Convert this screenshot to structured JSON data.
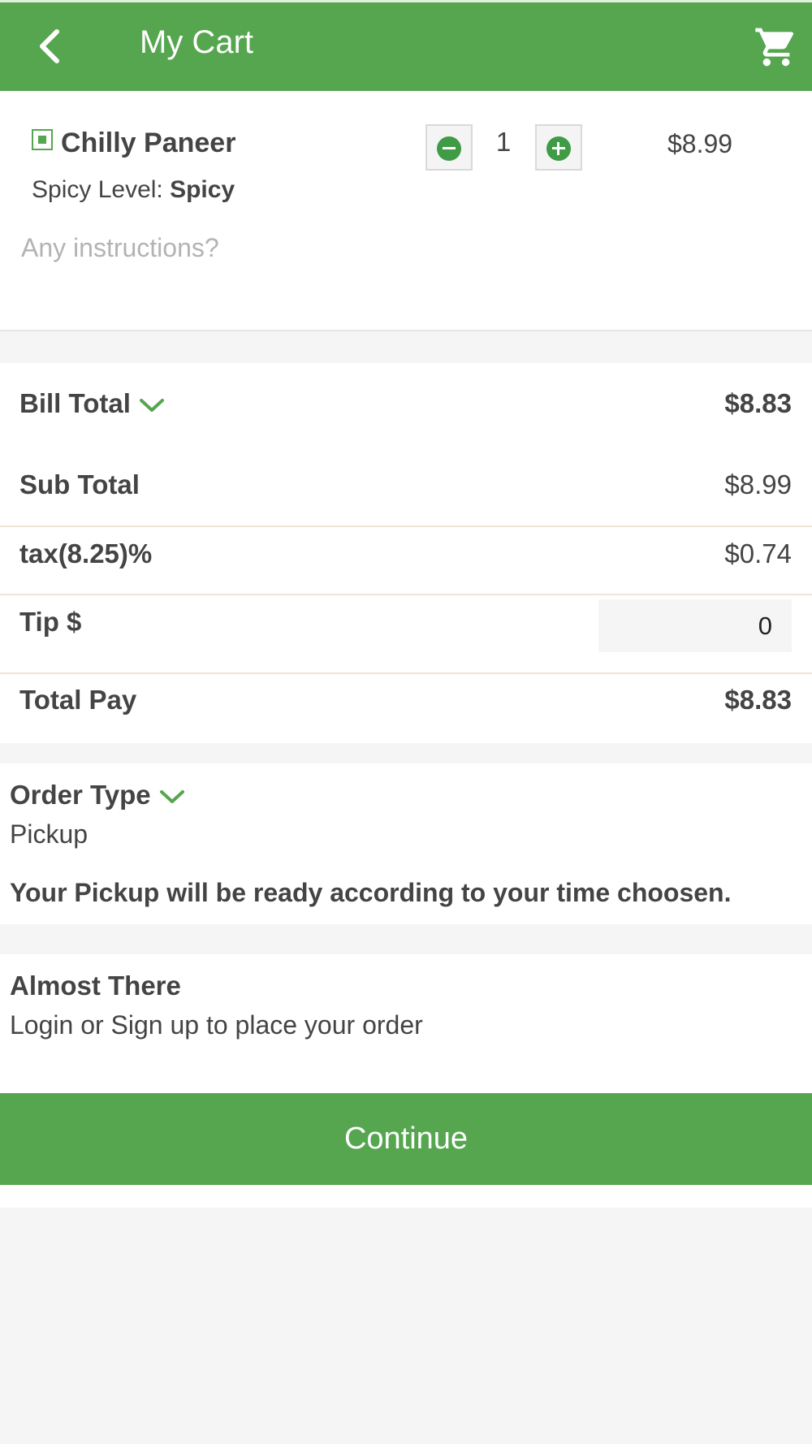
{
  "header": {
    "title": "My Cart",
    "back_icon": "chevron-left-icon",
    "cart_icon": "shopping-cart-icon"
  },
  "cart_item": {
    "name": "Chilly Paneer",
    "veg_icon": "veg-indicator-icon",
    "quantity": "1",
    "price": "$8.99",
    "spicy_label": "Spicy Level:",
    "spicy_value": "Spicy",
    "instructions_placeholder": "Any instructions?",
    "instructions_value": ""
  },
  "bill": {
    "bill_total_label": "Bill Total",
    "bill_total_value": "$8.83",
    "sub_total_label": "Sub Total",
    "sub_total_value": "$8.99",
    "tax_label": "tax(8.25)%",
    "tax_value": "$0.74",
    "tip_label": "Tip $",
    "tip_value": "0",
    "total_pay_label": "Total Pay",
    "total_pay_value": "$8.83"
  },
  "order": {
    "title": "Order Type",
    "type": "Pickup",
    "note": "Your Pickup will be ready according to your time choosen."
  },
  "checkout": {
    "title": "Almost There",
    "subtitle": "Login or Sign up to place your order",
    "continue_label": "Continue"
  },
  "colors": {
    "brand_green": "#55a64f",
    "button_green": "#3f9b45",
    "background": "#f5f5f5"
  }
}
